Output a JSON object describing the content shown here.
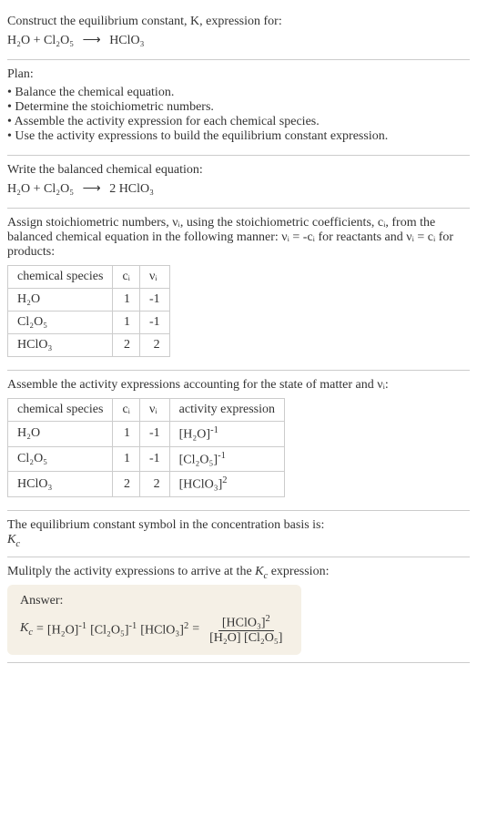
{
  "intro": {
    "line1": "Construct the equilibrium constant, K, expression for:",
    "reactant_eq_left": "H",
    "reactant_eq_full": "H₂O + Cl₂O₅",
    "arrow": "⟶",
    "reactant_eq_right": "HClO₃"
  },
  "plan": {
    "title": "Plan:",
    "items": [
      "Balance the chemical equation.",
      "Determine the stoichiometric numbers.",
      "Assemble the activity expression for each chemical species.",
      "Use the activity expressions to build the equilibrium constant expression."
    ]
  },
  "balanced": {
    "title": "Write the balanced chemical equation:",
    "left": "H₂O + Cl₂O₅",
    "arrow": "⟶",
    "right": "2 HClO₃"
  },
  "stoich": {
    "text1": "Assign stoichiometric numbers, νᵢ, using the stoichiometric coefficients, cᵢ, from the balanced chemical equation in the following manner: νᵢ = -cᵢ for reactants and νᵢ = cᵢ for products:",
    "headers": [
      "chemical species",
      "cᵢ",
      "νᵢ"
    ],
    "rows": [
      {
        "species": "H₂O",
        "c": "1",
        "v": "-1"
      },
      {
        "species": "Cl₂O₅",
        "c": "1",
        "v": "-1"
      },
      {
        "species": "HClO₃",
        "c": "2",
        "v": "2"
      }
    ]
  },
  "activity": {
    "title": "Assemble the activity expressions accounting for the state of matter and νᵢ:",
    "headers": [
      "chemical species",
      "cᵢ",
      "νᵢ",
      "activity expression"
    ],
    "rows": [
      {
        "species": "H₂O",
        "c": "1",
        "v": "-1",
        "expr_base": "[H₂O]",
        "expr_pow": "-1"
      },
      {
        "species": "Cl₂O₅",
        "c": "1",
        "v": "-1",
        "expr_base": "[Cl₂O₅]",
        "expr_pow": "-1"
      },
      {
        "species": "HClO₃",
        "c": "2",
        "v": "2",
        "expr_base": "[HClO₃]",
        "expr_pow": "2"
      }
    ]
  },
  "symbol": {
    "text": "The equilibrium constant symbol in the concentration basis is:",
    "sym": "K_c"
  },
  "multiply": {
    "text": "Mulitply the activity expressions to arrive at the K_c expression:"
  },
  "answer": {
    "label": "Answer:",
    "lhs": "K_c",
    "eq": "=",
    "term1_base": "[H₂O]",
    "term1_pow": "-1",
    "term2_base": "[Cl₂O₅]",
    "term2_pow": "-1",
    "term3_base": "[HClO₃]",
    "term3_pow": "2",
    "frac_num_base": "[HClO₃]",
    "frac_num_pow": "2",
    "frac_den": "[H₂O] [Cl₂O₅]"
  },
  "chart_data": {
    "type": "table",
    "tables": [
      {
        "title": "stoichiometric numbers",
        "headers": [
          "chemical species",
          "c_i",
          "ν_i"
        ],
        "rows": [
          [
            "H2O",
            1,
            -1
          ],
          [
            "Cl2O5",
            1,
            -1
          ],
          [
            "HClO3",
            2,
            2
          ]
        ]
      },
      {
        "title": "activity expressions",
        "headers": [
          "chemical species",
          "c_i",
          "ν_i",
          "activity expression"
        ],
        "rows": [
          [
            "H2O",
            1,
            -1,
            "[H2O]^-1"
          ],
          [
            "Cl2O5",
            1,
            -1,
            "[Cl2O5]^-1"
          ],
          [
            "HClO3",
            2,
            2,
            "[HClO3]^2"
          ]
        ]
      }
    ]
  }
}
